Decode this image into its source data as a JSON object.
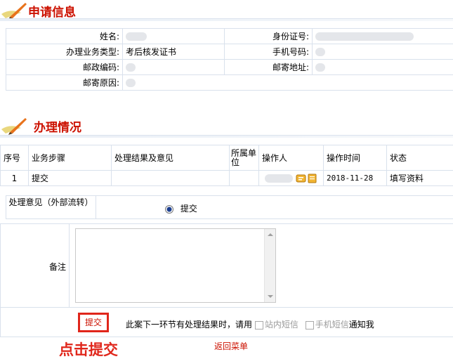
{
  "sections": {
    "apply_title": "申请信息",
    "process_title": "办理情况"
  },
  "info": {
    "name_label": "姓名:",
    "id_label": "身份证号:",
    "business_type_label": "办理业务类型:",
    "business_type_value": "考后核发证书",
    "phone_label": "手机号码:",
    "postcode_label": "邮政编码:",
    "address_label": "邮寄地址:",
    "reason_label": "邮寄原因:"
  },
  "process_table": {
    "headers": [
      "序号",
      "业务步骤",
      "处理结果及意见",
      "所属单位",
      "操作人",
      "操作时间",
      "状态"
    ],
    "rows": [
      {
        "no": "1",
        "step": "提交",
        "result": "",
        "unit": "",
        "time": "2018-11-28",
        "status": "填写资料"
      }
    ]
  },
  "opinion": {
    "label": "处理意见（外部流转）",
    "option": "提交"
  },
  "remark": {
    "label": "备注",
    "value": ""
  },
  "actions": {
    "submit_label": "提交",
    "notify_text_prefix": "此案下一环节有处理结果时，请用",
    "site_msg_label": "站内短信",
    "sms_label": "手机短信",
    "notify_text_suffix": "通知我",
    "back_label": "返回菜单",
    "click_hint": "点击提交"
  },
  "colors": {
    "title_red": "#cc1100",
    "accent_red": "#e0261b",
    "border": "#d9e1ec"
  }
}
